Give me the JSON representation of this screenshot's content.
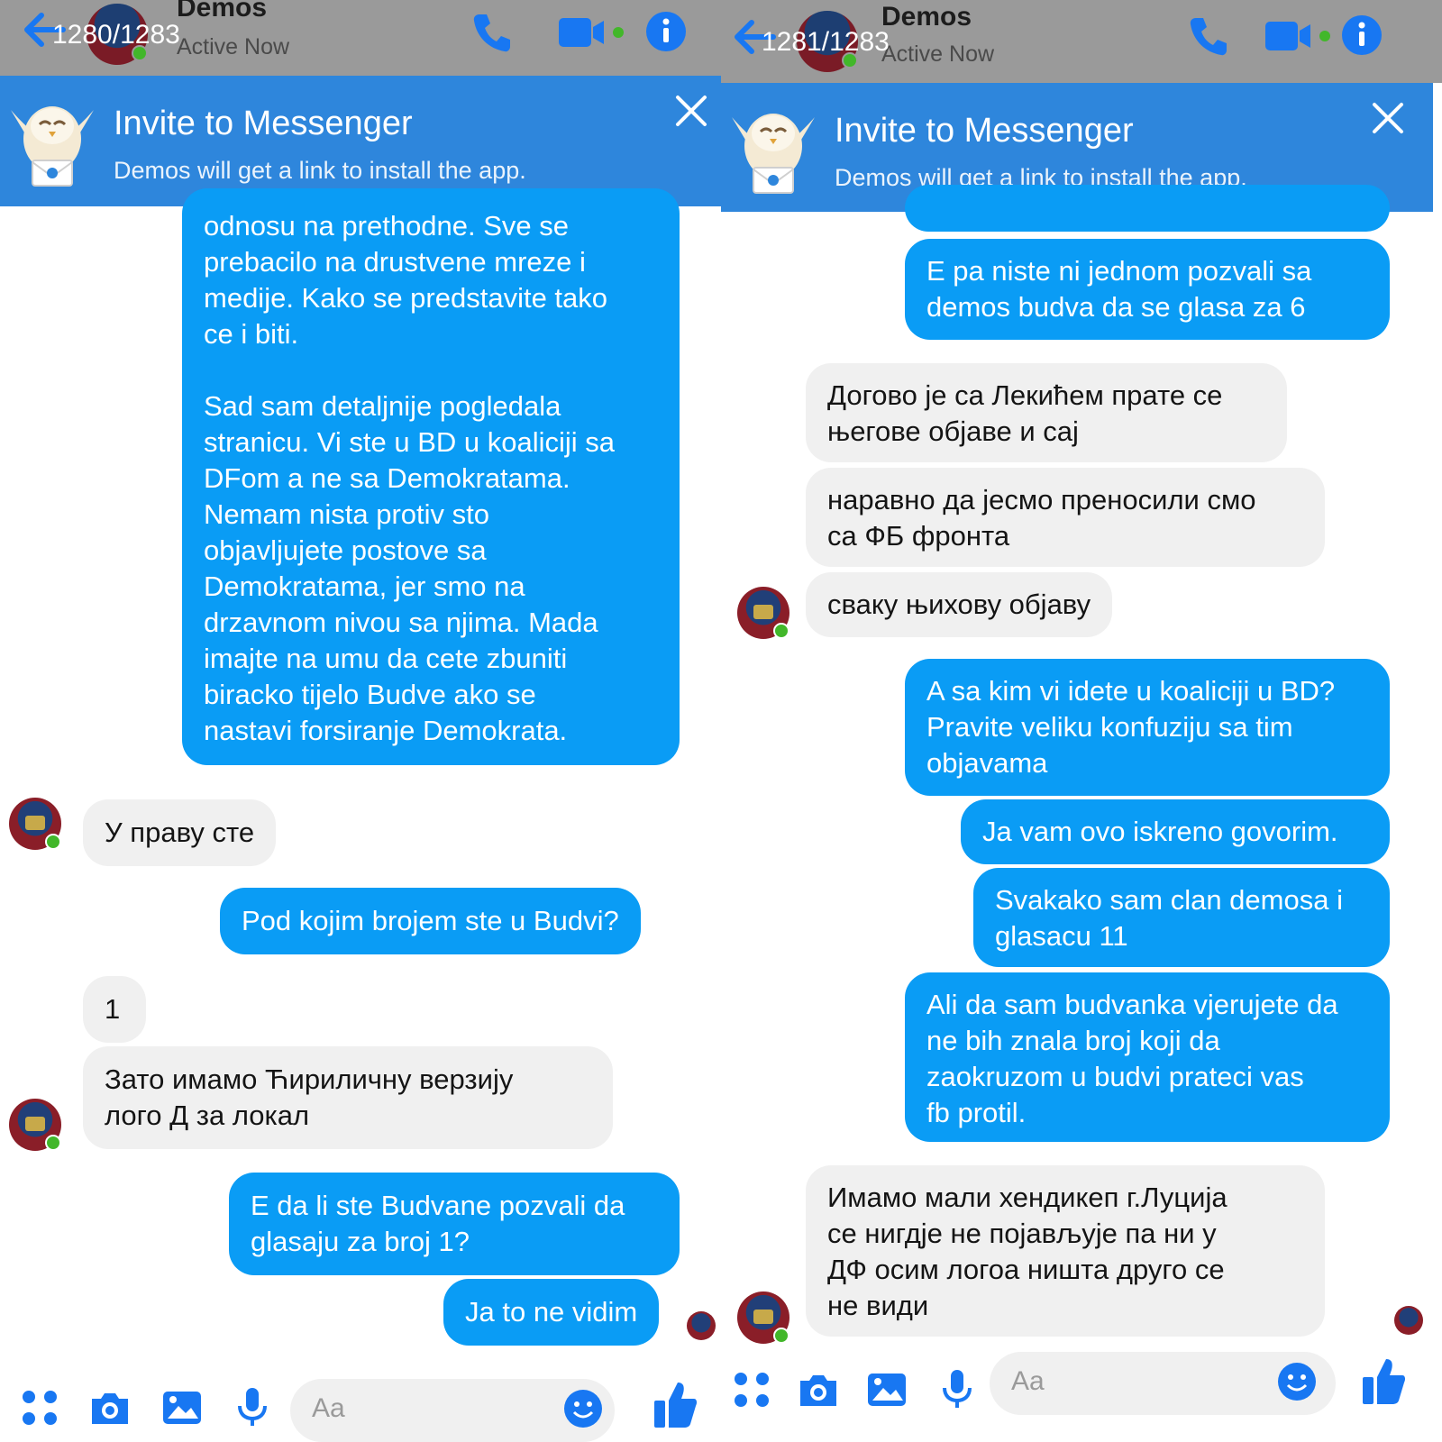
{
  "screens": [
    {
      "counter": "1280/1283",
      "contact_name": "Demos",
      "contact_status": "Active Now",
      "invite": {
        "title": "Invite to Messenger",
        "subtitle": "Demos will get a link to install the app."
      },
      "messages": [
        {
          "dir": "out",
          "lines": [
            "odnosu na prethodne. Sve se",
            "prebacilo na drustvene mreze i",
            "medije. Kako se predstavite tako",
            "ce i biti.",
            "",
            "Sad sam detaljnije pogledala",
            "stranicu. Vi ste u BD u koaliciji sa",
            "DFom a ne sa Demokratama.",
            "Nemam nista protiv sto",
            "objavljujete postove sa",
            "Demokratama, jer smo na",
            "drzavnom nivou sa njima. Mada",
            "imajte na umu da cete zbuniti",
            "biracko tijelo Budve ako se",
            "nastavi forsiranje Demokrata."
          ]
        },
        {
          "dir": "in",
          "lines": [
            "У праву сте"
          ]
        },
        {
          "dir": "out",
          "lines": [
            "Pod kojim brojem ste u Budvi?"
          ]
        },
        {
          "dir": "in",
          "lines": [
            "1"
          ]
        },
        {
          "dir": "in",
          "lines": [
            "Зато имамо Ћириличну верзију",
            "лого Д за локал"
          ]
        },
        {
          "dir": "out",
          "lines": [
            "E da li ste Budvane pozvali da",
            "glasaju za broj 1?"
          ]
        },
        {
          "dir": "out",
          "lines": [
            "Ja to ne vidim"
          ]
        }
      ],
      "composer_placeholder": "Aa"
    },
    {
      "counter": "1281/1283",
      "contact_name": "Demos",
      "contact_status": "Active Now",
      "invite": {
        "title": "Invite to Messenger",
        "subtitle": "Demos will get a link to install the app."
      },
      "messages": [
        {
          "dir": "out",
          "lines": [
            "E pa niste ni jednom pozvali sa",
            "demos budva da se glasa za 6"
          ]
        },
        {
          "dir": "in",
          "lines": [
            "Догово је са Лекићем прате се",
            "његове објаве и сај"
          ]
        },
        {
          "dir": "in",
          "lines": [
            "наравно да јесмо преносили смо",
            "са ФБ фронта"
          ]
        },
        {
          "dir": "in",
          "lines": [
            "сваку њихову објаву"
          ]
        },
        {
          "dir": "out",
          "lines": [
            "A sa kim vi idete u koaliciji u BD?",
            "Pravite veliku konfuziju sa tim",
            "objavama"
          ]
        },
        {
          "dir": "out",
          "lines": [
            "Ja vam ovo iskreno govorim."
          ]
        },
        {
          "dir": "out",
          "lines": [
            "Svakako sam clan demosa i",
            "glasacu 11"
          ]
        },
        {
          "dir": "out",
          "lines": [
            "Ali da sam budvanka vjerujete da",
            "ne bih znala broj koji da",
            "zaokruzom u budvi prateci vas",
            "fb protil."
          ]
        },
        {
          "dir": "in",
          "lines": [
            "Имамо мали хендикеп г.Луција",
            "се нигдје не појављује па ни у",
            "ДФ осим логоа ништа друго се",
            "не види"
          ]
        }
      ],
      "composer_placeholder": "Aa"
    }
  ],
  "icons": {
    "header": [
      "back-arrow-icon",
      "phone-icon",
      "video-camera-icon",
      "info-icon"
    ],
    "banner": [
      "owl-mascot-icon",
      "close-icon"
    ],
    "composer": [
      "apps-grid-icon",
      "camera-icon",
      "gallery-icon",
      "microphone-icon",
      "emoji-icon",
      "thumbs-up-icon"
    ]
  },
  "colors": {
    "accent": "#2e86dc",
    "outgoing_bubble": "#0a9cf5",
    "incoming_bubble": "#f0f0f0",
    "header_overlay": "#9a9a9a",
    "online": "#42b72a"
  }
}
